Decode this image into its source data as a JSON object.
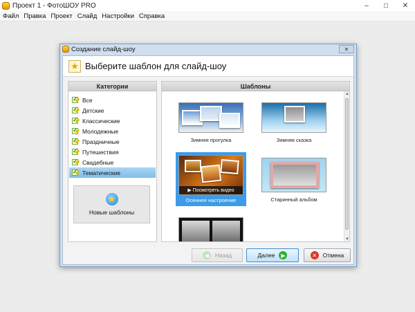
{
  "app": {
    "title": "Проект 1 - ФотоШОУ PRO",
    "controls": {
      "minimize": "–",
      "maximize": "□",
      "close": "✕"
    }
  },
  "menu": [
    "Файл",
    "Правка",
    "Проект",
    "Слайд",
    "Настройки",
    "Справка"
  ],
  "dialog": {
    "title": "Создание слайд-шоу",
    "close": "✕",
    "heading": "Выберите шаблон для слайд-шоу",
    "categories": {
      "header": "Категории",
      "items": [
        "Все",
        "Детские",
        "Классические",
        "Молодежные",
        "Праздничные",
        "Путешествия",
        "Свадебные",
        "Тематические"
      ],
      "selected": "Тематические"
    },
    "new_templates_label": "Новые шаблоны",
    "templates": {
      "header": "Шаблоны",
      "items": [
        {
          "label": "Зимняя прогулка"
        },
        {
          "label": "Зимняя сказка"
        },
        {
          "label": "Осеннее настроение",
          "preview_label": "Посмотреть видео"
        },
        {
          "label": "Старинный альбом"
        },
        {
          "label": ""
        }
      ],
      "selected": "Осеннее настроение"
    },
    "buttons": {
      "back": "Назад",
      "next": "Далее",
      "cancel": "Отмена"
    }
  },
  "colors": {
    "selection": "#3d9be9",
    "accent": "#7fbde9"
  }
}
